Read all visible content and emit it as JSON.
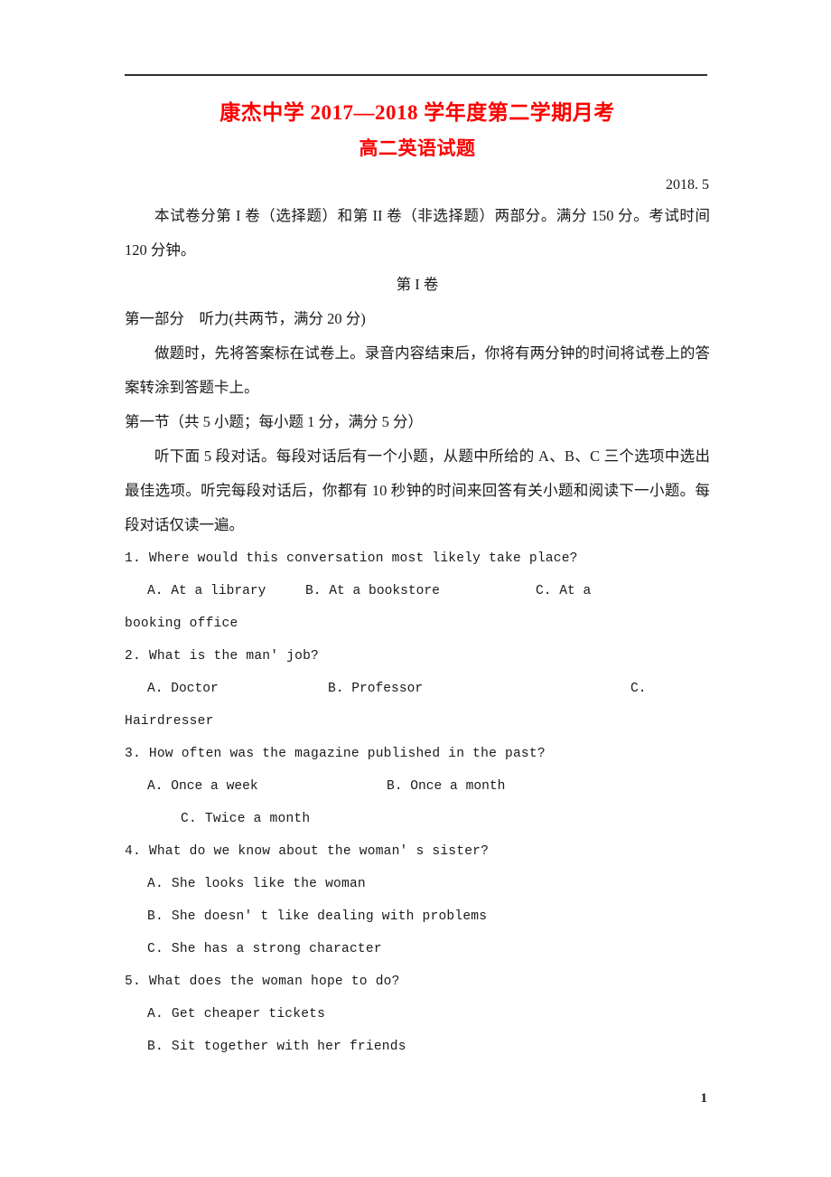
{
  "document": {
    "title": "康杰中学 2017—2018 学年度第二学期月考",
    "subtitle": "高二英语试题",
    "date": "2018. 5",
    "page_number": "1",
    "title_color": "#fc0000"
  },
  "intro": {
    "paper_structure": "本试卷分第 I 卷（选择题）和第 II 卷（非选择题）两部分。满分 150 分。考试时间 120 分钟。",
    "section_marker": "第 I 卷"
  },
  "part_one": {
    "heading": "第一部分　听力(共两节，满分 20 分)",
    "instruction": "做题时，先将答案标在试卷上。录音内容结束后，你将有两分钟的时间将试卷上的答案转涂到答题卡上。",
    "jie_heading": "第一节（共 5 小题；每小题 1 分，满分 5 分）",
    "jie_instruction": "听下面 5 段对话。每段对话后有一个小题，从题中所给的 A、B、C 三个选项中选出最佳选项。听完每段对话后，你都有 10 秒钟的时间来回答有关小题和阅读下一小题。每段对话仅读一遍。"
  },
  "questions": [
    {
      "stem": "1. Where would this conversation most likely take place?",
      "option_a": "A. At a library",
      "option_b": "B. At a bookstore",
      "option_c": "C. At a",
      "option_c_wrap": "booking office",
      "layout": "three-column-wrap"
    },
    {
      "stem": "2. What is the man' job?",
      "option_a": "A. Doctor",
      "option_b": "B. Professor",
      "option_c": "C.",
      "option_c_wrap": "Hairdresser",
      "layout": "three-column-wrap"
    },
    {
      "stem": "3. How often was the magazine published in the past?",
      "option_a": "A. Once a week",
      "option_b": "B. Once a month",
      "option_c": "C. Twice a month",
      "layout": "two-column-plus-deep-c"
    },
    {
      "stem": "4. What do we know about the woman' s sister?",
      "option_a": "A. She looks like the woman",
      "option_b": "B. She doesn' t like dealing with problems",
      "option_c": "C. She has a strong character",
      "layout": "stacked"
    },
    {
      "stem": "5. What does the woman hope to do?",
      "option_a": "A. Get cheaper tickets",
      "option_b": "B. Sit together with her friends",
      "layout": "stacked-partial"
    }
  ]
}
